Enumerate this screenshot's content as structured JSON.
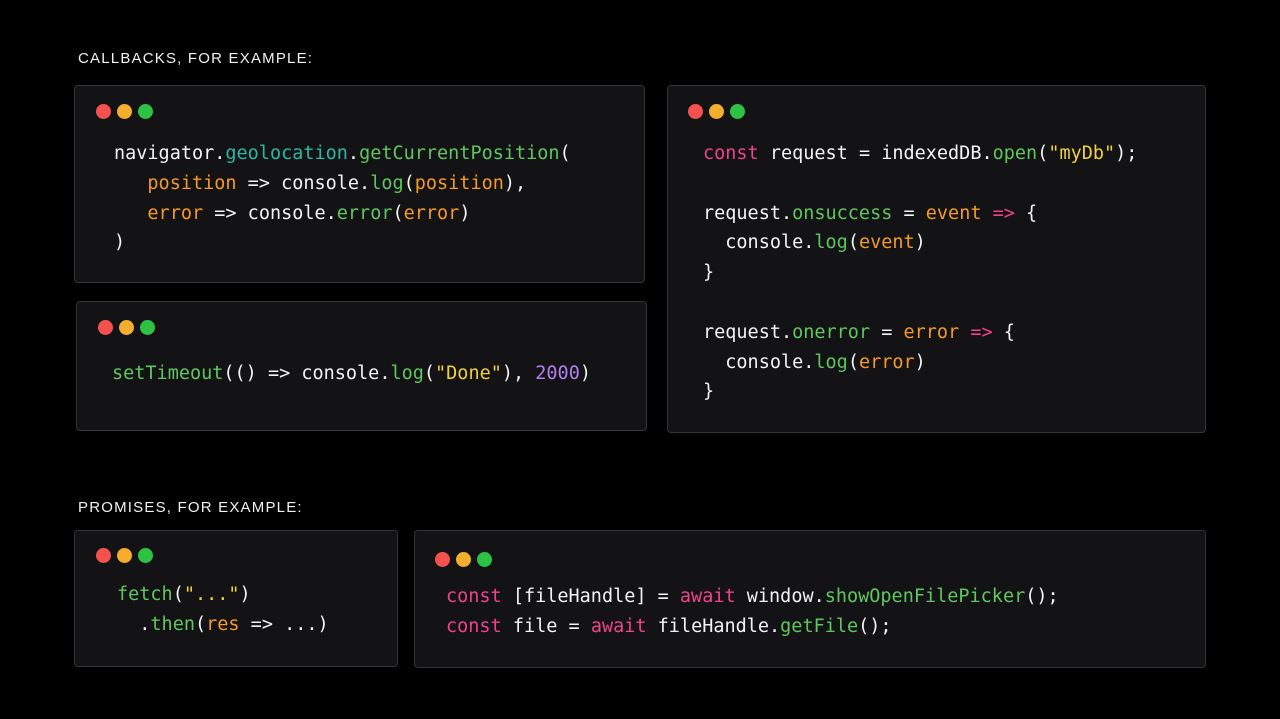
{
  "headings": {
    "callbacks": "CALLBACKS, FOR EXAMPLE:",
    "promises": "PROMISES, FOR EXAMPLE:"
  },
  "colors": {
    "background": "#000000",
    "window": "#131316",
    "window_border": "#34343a",
    "plain": "#f3f3f3",
    "function": "#5fc75e",
    "property": "#2db7a4",
    "parameter": "#f59a26",
    "keyword": "#f0428e",
    "string": "#f2d13c",
    "number": "#b27ef0",
    "dot_close": "#f4524f",
    "dot_minimize": "#f5ad2e",
    "dot_zoom": "#2ec245"
  },
  "snippets": [
    {
      "id": "geolocation",
      "lines": [
        [
          [
            "p",
            "navigator."
          ],
          [
            "g",
            "geolocation"
          ],
          [
            "p",
            "."
          ],
          [
            "f",
            "getCurrentPosition"
          ],
          [
            "p",
            "("
          ]
        ],
        [
          [
            "p",
            "   "
          ],
          [
            "o",
            "position"
          ],
          [
            "p",
            " => console."
          ],
          [
            "f",
            "log"
          ],
          [
            "p",
            "("
          ],
          [
            "o",
            "position"
          ],
          [
            "p",
            "),"
          ]
        ],
        [
          [
            "p",
            "   "
          ],
          [
            "o",
            "error"
          ],
          [
            "p",
            " => console."
          ],
          [
            "f",
            "error"
          ],
          [
            "p",
            "("
          ],
          [
            "o",
            "error"
          ],
          [
            "p",
            ")"
          ]
        ],
        [
          [
            "p",
            ")"
          ]
        ]
      ]
    },
    {
      "id": "settimeout",
      "lines": [
        [
          [
            "f",
            "setTimeout"
          ],
          [
            "p",
            "(() => console."
          ],
          [
            "f",
            "log"
          ],
          [
            "p",
            "("
          ],
          [
            "s",
            "\"Done\""
          ],
          [
            "p",
            "), "
          ],
          [
            "n",
            "2000"
          ],
          [
            "p",
            ")"
          ]
        ]
      ]
    },
    {
      "id": "indexeddb",
      "lines": [
        [
          [
            "k",
            "const"
          ],
          [
            "p",
            " request = indexedDB."
          ],
          [
            "f",
            "open"
          ],
          [
            "p",
            "("
          ],
          [
            "s",
            "\"myDb\""
          ],
          [
            "p",
            ");"
          ]
        ],
        [],
        [
          [
            "p",
            "request."
          ],
          [
            "f",
            "onsuccess"
          ],
          [
            "p",
            " = "
          ],
          [
            "o",
            "event"
          ],
          [
            "p",
            " "
          ],
          [
            "k",
            "=>"
          ],
          [
            "p",
            " {"
          ]
        ],
        [
          [
            "p",
            "  console."
          ],
          [
            "f",
            "log"
          ],
          [
            "p",
            "("
          ],
          [
            "o",
            "event"
          ],
          [
            "p",
            ")"
          ]
        ],
        [
          [
            "p",
            "}"
          ]
        ],
        [],
        [
          [
            "p",
            "request."
          ],
          [
            "f",
            "onerror"
          ],
          [
            "p",
            " = "
          ],
          [
            "o",
            "error"
          ],
          [
            "p",
            " "
          ],
          [
            "k",
            "=>"
          ],
          [
            "p",
            " {"
          ]
        ],
        [
          [
            "p",
            "  console."
          ],
          [
            "f",
            "log"
          ],
          [
            "p",
            "("
          ],
          [
            "o",
            "error"
          ],
          [
            "p",
            ")"
          ]
        ],
        [
          [
            "p",
            "}"
          ]
        ]
      ]
    },
    {
      "id": "fetch",
      "lines": [
        [
          [
            "f",
            "fetch"
          ],
          [
            "p",
            "("
          ],
          [
            "s",
            "\"...\""
          ],
          [
            "p",
            ")"
          ]
        ],
        [
          [
            "p",
            "  ."
          ],
          [
            "f",
            "then"
          ],
          [
            "p",
            "("
          ],
          [
            "o",
            "res"
          ],
          [
            "p",
            " => ...)"
          ]
        ]
      ]
    },
    {
      "id": "filepicker",
      "lines": [
        [
          [
            "k",
            "const"
          ],
          [
            "p",
            " [fileHandle] = "
          ],
          [
            "k",
            "await"
          ],
          [
            "p",
            " window."
          ],
          [
            "f",
            "showOpenFilePicker"
          ],
          [
            "p",
            "();"
          ]
        ],
        [
          [
            "k",
            "const"
          ],
          [
            "p",
            " file = "
          ],
          [
            "k",
            "await"
          ],
          [
            "p",
            " fileHandle."
          ],
          [
            "f",
            "getFile"
          ],
          [
            "p",
            "();"
          ]
        ]
      ]
    }
  ]
}
